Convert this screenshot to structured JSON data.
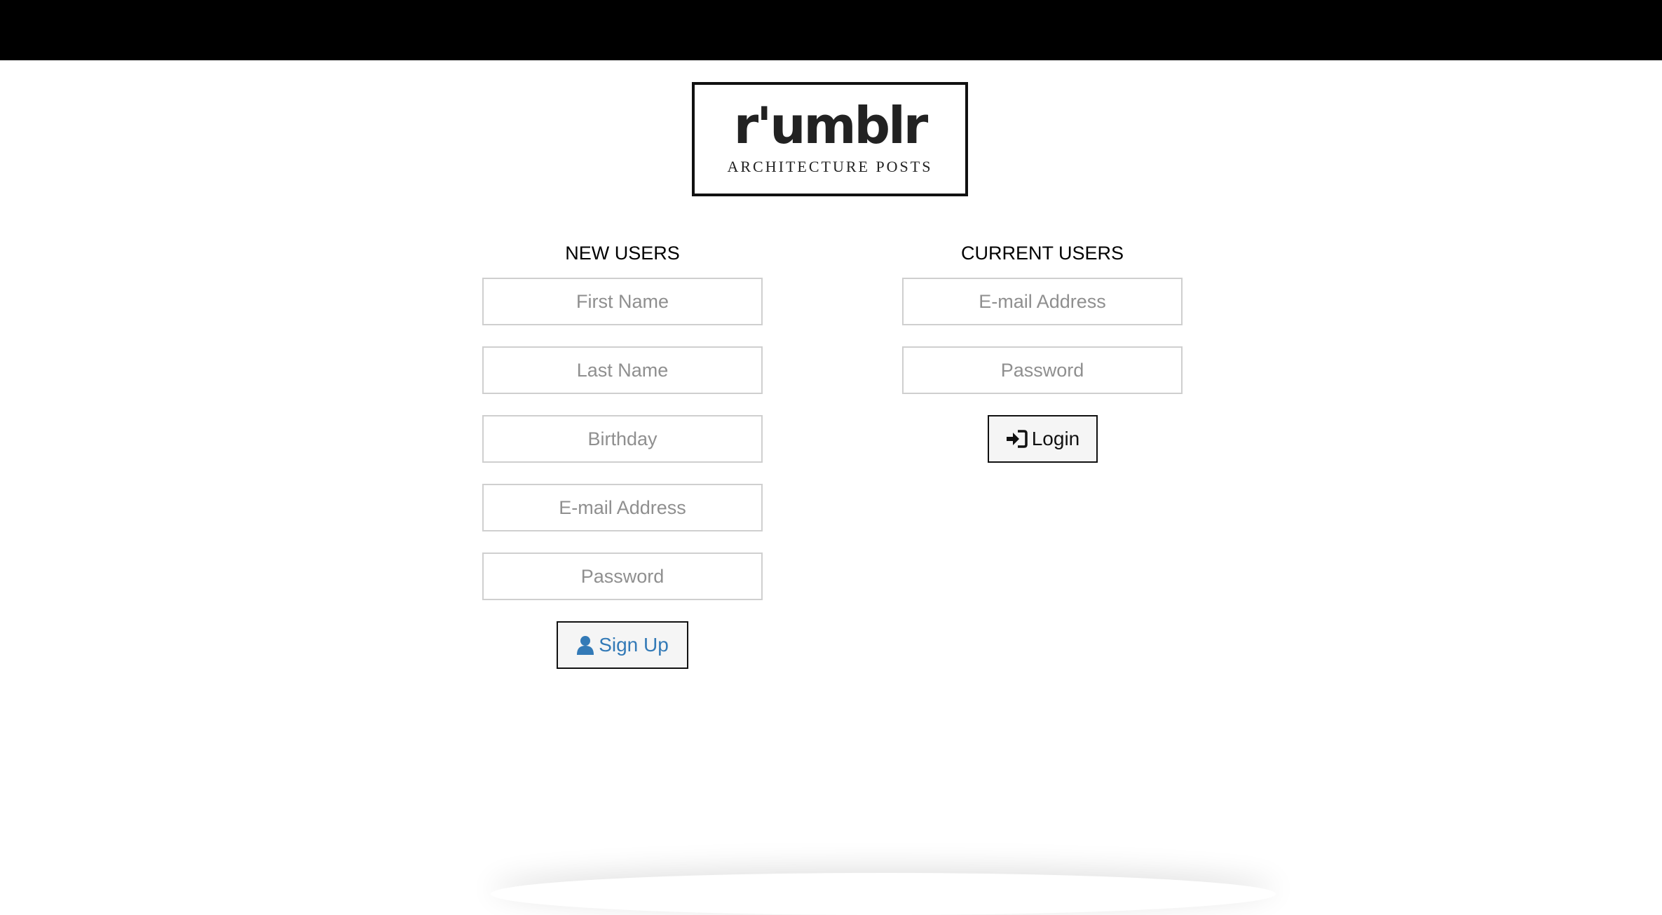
{
  "logo": {
    "word": "r'umblr",
    "subtitle": "ARCHITECTURE POSTS"
  },
  "new_users": {
    "title": "NEW USERS",
    "fields": {
      "first_name": "First Name",
      "last_name": "Last Name",
      "birthday": "Birthday",
      "email": "E-mail Address",
      "password": "Password"
    },
    "signup_label": "Sign Up"
  },
  "current_users": {
    "title": "CURRENT USERS",
    "fields": {
      "email": "E-mail Address",
      "password": "Password"
    },
    "login_label": "Login"
  },
  "colors": {
    "topbar": "#000000",
    "signup_accent": "#337ab7",
    "field_border": "#cfcfcf"
  },
  "icons": {
    "signup": "user-icon",
    "login": "sign-in-icon"
  }
}
